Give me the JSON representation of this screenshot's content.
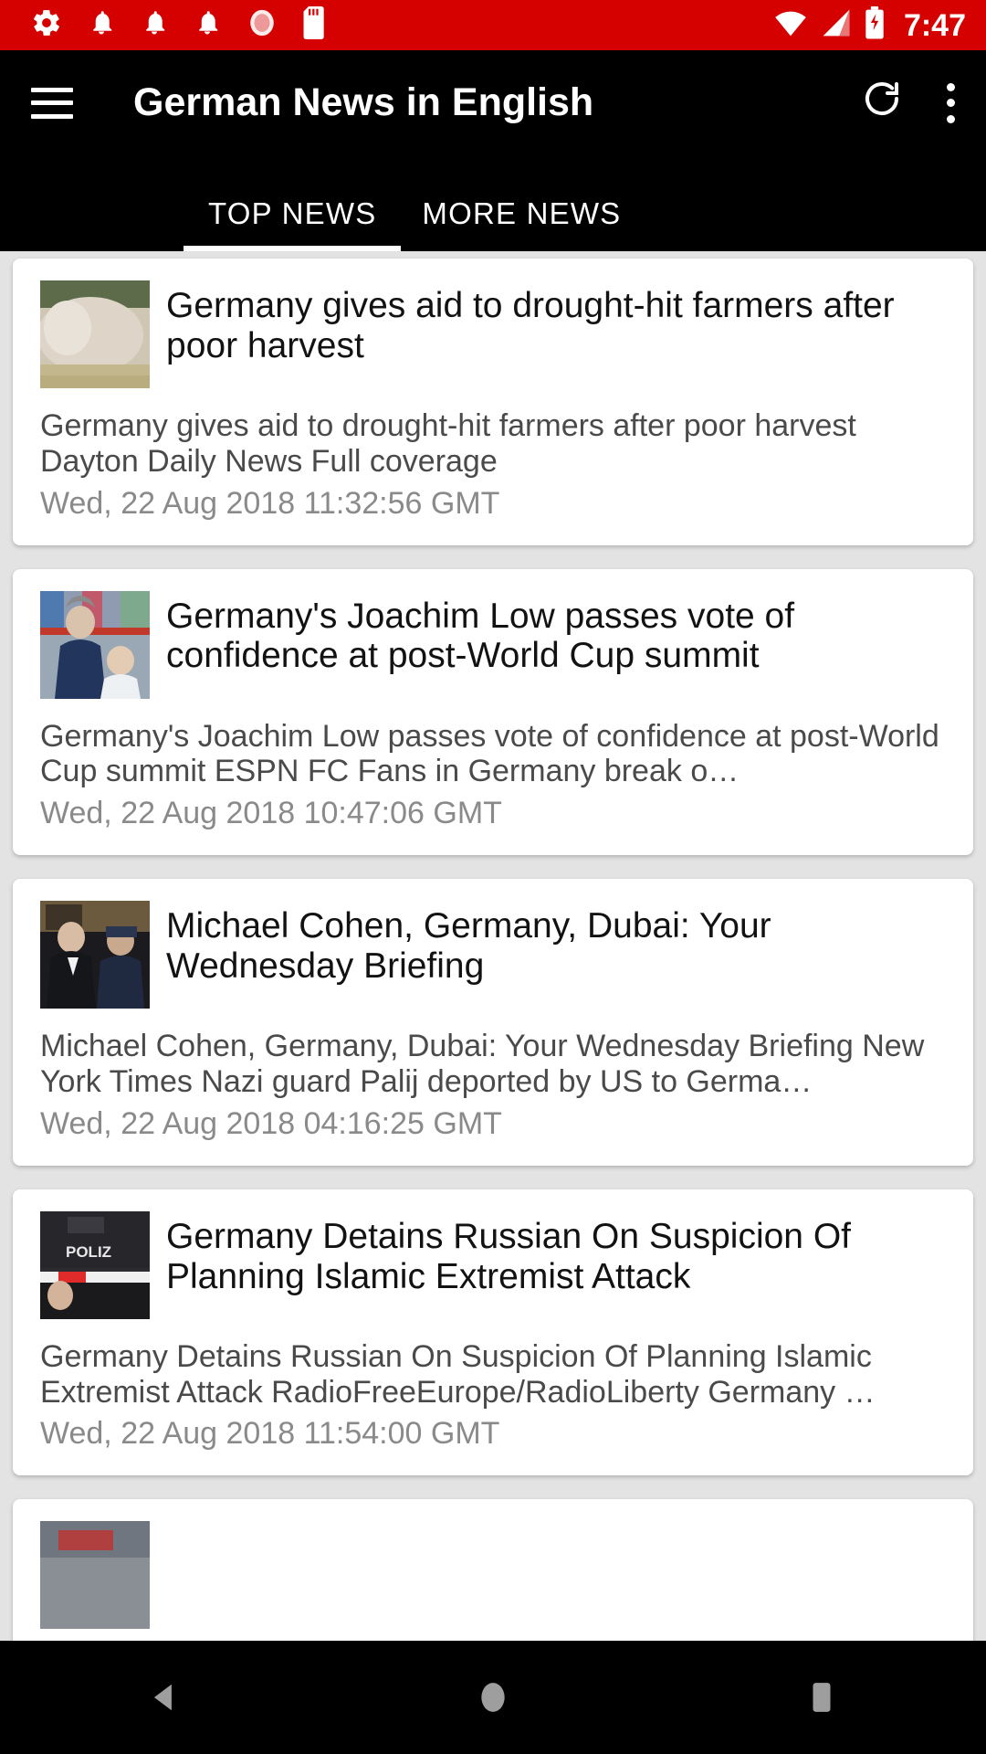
{
  "status_bar": {
    "background_color": "#d50000",
    "time": "7:47",
    "left_icons": [
      "settings-gear-icon",
      "notification-bell-icon",
      "notification-bell-icon",
      "notification-bell-icon",
      "alarm-icon",
      "sd-card-icon"
    ],
    "right_icons": [
      "wifi-icon",
      "cellular-signal-icon",
      "battery-charging-icon"
    ]
  },
  "appbar": {
    "background_color": "#000000",
    "title": "German News in English",
    "menu_icon": "hamburger-menu-icon",
    "refresh_icon": "refresh-icon",
    "overflow_icon": "more-vertical-icon"
  },
  "tabs": {
    "items": [
      {
        "label": "TOP NEWS",
        "active": true
      },
      {
        "label": "MORE NEWS",
        "active": false
      }
    ],
    "indicator_color": "#ffffff"
  },
  "articles": [
    {
      "headline": "Germany gives aid to drought-hit farmers after poor harvest",
      "description": "Germany gives aid to drought-hit farmers after poor harvest Dayton Daily News  Full coverage",
      "date": "Wed, 22 Aug 2018 11:32:56 GMT",
      "thumbnail": "dust-field-photo"
    },
    {
      "headline": "Germany's Joachim Low passes vote of confidence at post-World Cup summit",
      "description": "Germany's Joachim Low passes vote of confidence at post-World Cup summit  ESPN FC  Fans in Germany break o…",
      "date": "Wed, 22 Aug 2018 10:47:06 GMT",
      "thumbnail": "joachim-low-photo"
    },
    {
      "headline": "Michael Cohen, Germany, Dubai: Your Wednesday Briefing",
      "description": "Michael Cohen, Germany, Dubai: Your Wednesday Briefing New York Times  Nazi guard Palij deported by US to Germa…",
      "date": "Wed, 22 Aug 2018 04:16:25 GMT",
      "thumbnail": "michael-cohen-photo"
    },
    {
      "headline": "Germany Detains Russian On Suspicion Of Planning Islamic Extremist Attack",
      "description": "Germany Detains Russian On Suspicion Of Planning Islamic Extremist Attack  RadioFreeEurope/RadioLiberty  Germany …",
      "date": "Wed, 22 Aug 2018 11:54:00 GMT",
      "thumbnail": "polizei-barrier-photo"
    }
  ],
  "navbar": {
    "background_color": "#000000",
    "buttons": [
      "back-icon",
      "home-icon",
      "recents-icon"
    ]
  }
}
